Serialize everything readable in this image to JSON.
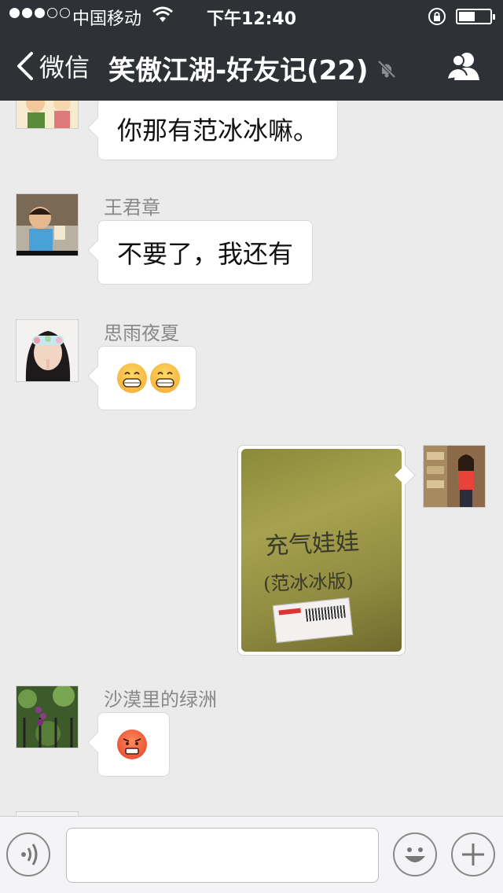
{
  "status_bar": {
    "carrier": "中国移动",
    "time": "下午12:40",
    "signal_bars_filled": 3,
    "signal_bars_total": 5
  },
  "nav": {
    "back_label": "微信",
    "title": "笑傲江湖-好友记(22)",
    "icons": [
      "chevron-left-icon",
      "mute-bell-icon",
      "group-members-icon"
    ]
  },
  "messages": [
    {
      "id": "m1",
      "side": "left",
      "sender": "",
      "text": "你那有范冰冰嘛。",
      "avatar": "cartoon-avatar"
    },
    {
      "id": "m2",
      "side": "left",
      "sender": "王君章",
      "text": "不要了，我还有",
      "avatar": "child-avatar"
    },
    {
      "id": "m3",
      "side": "left",
      "sender": "思雨夜夏",
      "emojis": [
        "grin-emoji",
        "grin-emoji"
      ],
      "avatar": "girl-avatar"
    },
    {
      "id": "m4",
      "side": "right",
      "type": "image",
      "image_text_line1": "充气娃娃",
      "image_text_line2": "(范冰冰版)",
      "avatar": "shop-woman-avatar"
    },
    {
      "id": "m5",
      "side": "left",
      "sender": "沙漠里的绿洲",
      "emojis": [
        "angry-emoji"
      ],
      "avatar": "plant-avatar"
    }
  ],
  "input_bar": {
    "placeholder": "",
    "value": "",
    "icons": [
      "voice-icon",
      "smiley-icon",
      "plus-icon"
    ]
  },
  "colors": {
    "topbar": "#2e3136",
    "chat_background": "#ebebeb",
    "bubble": "#ffffff"
  }
}
